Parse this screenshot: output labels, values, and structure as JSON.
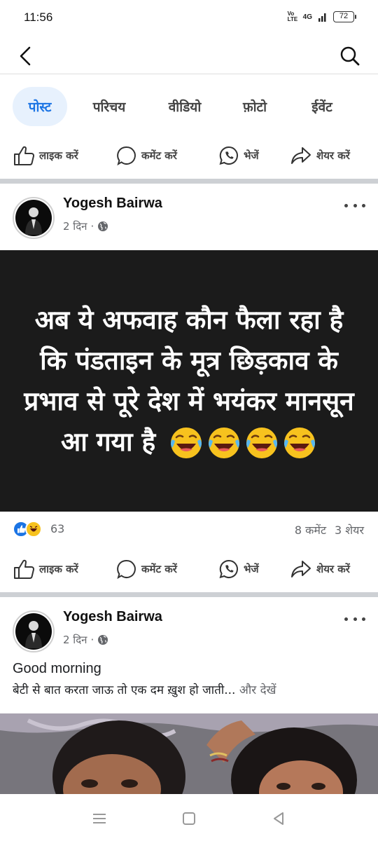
{
  "status_bar": {
    "time": "11:56",
    "volte": "Vo LTE",
    "network": "4G",
    "battery": "72"
  },
  "tabs": [
    {
      "label": "पोस्ट",
      "active": true
    },
    {
      "label": "परिचय",
      "active": false
    },
    {
      "label": "वीडियो",
      "active": false
    },
    {
      "label": "फ़ोटो",
      "active": false
    },
    {
      "label": "ईवेंट",
      "active": false
    }
  ],
  "actions": {
    "like": "लाइक करें",
    "comment": "कमेंट करें",
    "send": "भेजें",
    "share": "शेयर करें"
  },
  "posts": [
    {
      "author": "Yogesh Bairwa",
      "time": "2 दिन",
      "privacy_icon": "globe-icon",
      "card_text": "अब ये अफवाह कौन फैला रहा है कि पंडताइन के मूत्र छिड़काव के प्रभाव से पूरे देश में भयंकर मानसून आ गया है",
      "card_emojis": [
        "laughing-crying-emoji",
        "laughing-crying-emoji",
        "laughing-crying-emoji",
        "laughing-crying-emoji"
      ],
      "reaction_icons": [
        "like-reaction-icon",
        "haha-reaction-icon"
      ],
      "reaction_count": "63",
      "comments": "8 कमेंट",
      "shares": "3 शेयर"
    },
    {
      "author": "Yogesh Bairwa",
      "time": "2 दिन",
      "privacy_icon": "globe-icon",
      "caption_line1": "Good morning",
      "caption_line2": "बेटी से बात करता जाऊ तो एक दम ख़ुश हो जाती...",
      "see_more": "और देखें"
    }
  ],
  "colors": {
    "accent": "#1b74e4",
    "active_tab_bg": "#e7f1fd",
    "card_bg": "#1b1b1b",
    "divider": "#cdd0d4"
  }
}
